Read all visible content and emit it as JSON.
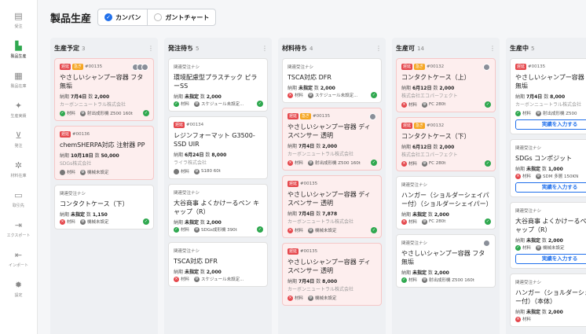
{
  "sidebar": {
    "items": [
      {
        "label": "受注",
        "icon": "clipboard-icon",
        "active": false
      },
      {
        "label": "製品生産",
        "icon": "factory-icon",
        "active": true
      },
      {
        "label": "製品在庫",
        "icon": "inventory-icon",
        "active": false
      },
      {
        "label": "生産実績",
        "icon": "sparkle-icon",
        "active": false
      },
      {
        "label": "発注",
        "icon": "cart-icon",
        "active": false
      },
      {
        "label": "材料在庫",
        "icon": "molecule-icon",
        "active": false
      },
      {
        "label": "取引先",
        "icon": "book-icon",
        "active": false
      },
      {
        "label": "エクスポート",
        "icon": "export-icon",
        "active": false
      },
      {
        "label": "インポート",
        "icon": "import-icon",
        "active": false
      },
      {
        "label": "設定",
        "icon": "gear-icon",
        "active": false
      }
    ]
  },
  "header": {
    "title": "製品生産",
    "view_kanban": "カンバン",
    "view_gantt": "ガントチャート"
  },
  "columns": [
    {
      "title": "生産予定",
      "count": "3",
      "cards": [
        {
          "alert": true,
          "tags": [
            "遅延",
            "急ぎ"
          ],
          "id": "#00135",
          "title": "やさしいシャンプー容器 フタ 無垢",
          "due_label": "納期",
          "due": "7月4日",
          "qty_label": "数",
          "qty": "2,000",
          "company": "カーボンニュートラル株式会社",
          "mat_label": "材料",
          "mat_status": "green",
          "machine": "射出成形機 Z500 160t",
          "avatars": 3,
          "done": true
        },
        {
          "alert": true,
          "tags": [
            "遅延"
          ],
          "id": "#00136",
          "title": "chemSHERPA対応 注射器 PP",
          "due_label": "納期",
          "due": "10月18日",
          "qty_label": "数",
          "qty": "50,000",
          "company": "SDGs株式会社",
          "mat_label": "材料",
          "mat_status": "gray",
          "machine": "機械未設定",
          "avatars": 0,
          "done": false
        },
        {
          "alert": false,
          "tags": [],
          "plain": "関連受注ナシ",
          "title": "コンタクトケース（下）",
          "due_label": "納期",
          "due": "未指定",
          "qty_label": "数",
          "qty": "1,150",
          "company": "",
          "mat_label": "材料",
          "mat_status": "red",
          "machine": "機械未設定",
          "avatars": 0,
          "done": true
        }
      ]
    },
    {
      "title": "発注待ち",
      "count": "5",
      "cards": [
        {
          "alert": false,
          "tags": [],
          "plain": "関連受注ナシ",
          "title": "環境配慮型プラスチック ピラーSS",
          "due_label": "納期",
          "due": "未指定",
          "qty_label": "数",
          "qty": "2,000",
          "company": "",
          "mat_label": "材料",
          "mat_status": "green",
          "machine": "スケジュール未設定...",
          "avatars": 0,
          "done": true
        },
        {
          "alert": false,
          "tags": [
            "遅延"
          ],
          "id": "#00134",
          "title": "レジンフォーマット G3500-SSD UIR",
          "due_label": "納期",
          "due": "6月24日",
          "qty_label": "数",
          "qty": "8,000",
          "company": "ライラ株式会社",
          "mat_label": "材料",
          "mat_status": "gray",
          "machine": "S180 60t",
          "avatars": 0,
          "done": false
        },
        {
          "alert": false,
          "tags": [],
          "plain": "関連受注ナシ",
          "title": "大谷商事 よくかけーるペン キャップ（R）",
          "due_label": "納期",
          "due": "未指定",
          "qty_label": "数",
          "qty": "2,000",
          "company": "",
          "mat_label": "材料",
          "mat_status": "green",
          "machine": "SDGs成形機 390t",
          "avatars": 0,
          "done": true
        },
        {
          "alert": false,
          "tags": [],
          "plain": "関連受注ナシ",
          "title": "TSCA対応 DFR",
          "due_label": "納期",
          "due": "未指定",
          "qty_label": "数",
          "qty": "2,000",
          "company": "",
          "mat_label": "材料",
          "mat_status": "red",
          "machine": "スケジュール未設定...",
          "avatars": 0,
          "done": false
        }
      ]
    },
    {
      "title": "材料待ち",
      "count": "4",
      "cards": [
        {
          "alert": false,
          "tags": [],
          "plain": "関連受注ナシ",
          "title": "TSCA対応 DFR",
          "due_label": "納期",
          "due": "未指定",
          "qty_label": "数",
          "qty": "2,000",
          "company": "",
          "mat_label": "材料",
          "mat_status": "red",
          "machine": "スケジュール未設定...",
          "avatars": 0,
          "done": true
        },
        {
          "alert": true,
          "tags": [
            "遅延",
            "急ぎ"
          ],
          "id": "#00135",
          "title": "やさしいシャンプー容器 ディスペンサー 透明",
          "due_label": "納期",
          "due": "7月4日",
          "qty_label": "数",
          "qty": "2,000",
          "company": "カーボンニュートラル株式会社",
          "mat_label": "材料",
          "mat_status": "red",
          "machine": "射出成形機 Z500 160t",
          "avatars": 1,
          "done": true
        },
        {
          "alert": true,
          "tags": [
            "遅延"
          ],
          "id": "#00135",
          "title": "やさしいシャンプー容器 ディスペンサー 透明",
          "due_label": "納期",
          "due": "7月4日",
          "qty_label": "数",
          "qty": "7,878",
          "company": "カーボンニュートラル株式会社",
          "mat_label": "材料",
          "mat_status": "red",
          "machine": "機械未設定",
          "avatars": 0,
          "done": true
        },
        {
          "alert": true,
          "tags": [
            "遅延"
          ],
          "id": "#00135",
          "title": "やさしいシャンプー容器 ディスペンサー 透明",
          "due_label": "納期",
          "due": "7月4日",
          "qty_label": "数",
          "qty": "8,000",
          "company": "カーボンニュートラル株式会社",
          "mat_label": "材料",
          "mat_status": "red",
          "machine": "機械未設定",
          "avatars": 0,
          "done": false
        }
      ]
    },
    {
      "title": "生産可",
      "count": "14",
      "cards": [
        {
          "alert": true,
          "tags": [
            "遅延",
            "急ぎ"
          ],
          "id": "#00132",
          "title": "コンタクトケース（上）",
          "due_label": "納期",
          "due": "6月12日",
          "qty_label": "数",
          "qty": "2,000",
          "company": "株式会社エコパーフェクト",
          "mat_label": "材料",
          "mat_status": "red",
          "machine": "FC 280t",
          "avatars": 1,
          "done": true
        },
        {
          "alert": true,
          "tags": [
            "遅延",
            "急ぎ"
          ],
          "id": "#00132",
          "title": "コンタクトケース（下）",
          "due_label": "納期",
          "due": "6月12日",
          "qty_label": "数",
          "qty": "2,000",
          "company": "株式会社エコパーフェクト",
          "mat_label": "材料",
          "mat_status": "red",
          "machine": "FC 280t",
          "avatars": 0,
          "done": true
        },
        {
          "alert": false,
          "tags": [],
          "plain": "関連受注ナシ",
          "title": "ハンガー（ショルダーシェイパー付）（ショルダーシェイパー）",
          "due_label": "納期",
          "due": "未指定",
          "qty_label": "数",
          "qty": "2,000",
          "company": "",
          "mat_label": "材料",
          "mat_status": "red",
          "machine": "FC 280t",
          "avatars": 0,
          "done": true
        },
        {
          "alert": false,
          "tags": [],
          "plain": "関連受注ナシ",
          "title": "やさしいシャンプー容器 フタ 無垢",
          "due_label": "納期",
          "due": "未指定",
          "qty_label": "数",
          "qty": "2,000",
          "company": "",
          "mat_label": "材料",
          "mat_status": "green",
          "machine": "射出成形機 Z500 160t",
          "avatars": 1,
          "done": false
        }
      ]
    },
    {
      "title": "生産中",
      "count": "5",
      "cards": [
        {
          "alert": false,
          "tags": [
            "遅延"
          ],
          "id": "#00135",
          "title": "やさしいシャンプー容器 フタ 無垢",
          "due_label": "納期",
          "due": "7月4日",
          "qty_label": "数",
          "qty": "8,000",
          "company": "カーボンニュートラル株式会社",
          "mat_label": "材料",
          "mat_status": "green",
          "machine": "射出成形機 Z500",
          "avatars": 0,
          "done": false,
          "action": "実績を入力する"
        },
        {
          "alert": false,
          "tags": [],
          "plain": "関連受注ナシ",
          "title": "SDGs コンポジット",
          "due_label": "納期",
          "due": "未指定",
          "qty_label": "数",
          "qty": "1,000",
          "company": "",
          "mat_label": "材料",
          "mat_status": "red",
          "machine": "SDM 多層 150KN",
          "avatars": 0,
          "done": false,
          "action": "実績を入力する"
        },
        {
          "alert": false,
          "tags": [],
          "plain": "関連受注ナシ",
          "title": "大谷商事 よくかけーるペン キャップ（R）",
          "due_label": "納期",
          "due": "未指定",
          "qty_label": "数",
          "qty": "2,000",
          "company": "",
          "mat_label": "材料",
          "mat_status": "green",
          "machine": "機械未設定",
          "avatars": 0,
          "done": false,
          "action": "実績を入力する"
        },
        {
          "alert": false,
          "tags": [],
          "plain": "関連受注ナシ",
          "title": "ハンガー（ショルダーシェイパー付）（本体）",
          "due_label": "納期",
          "due": "未指定",
          "qty_label": "数",
          "qty": "2,000",
          "company": "",
          "mat_label": "材料",
          "mat_status": "red",
          "machine": "",
          "avatars": 0,
          "done": false
        }
      ]
    }
  ]
}
